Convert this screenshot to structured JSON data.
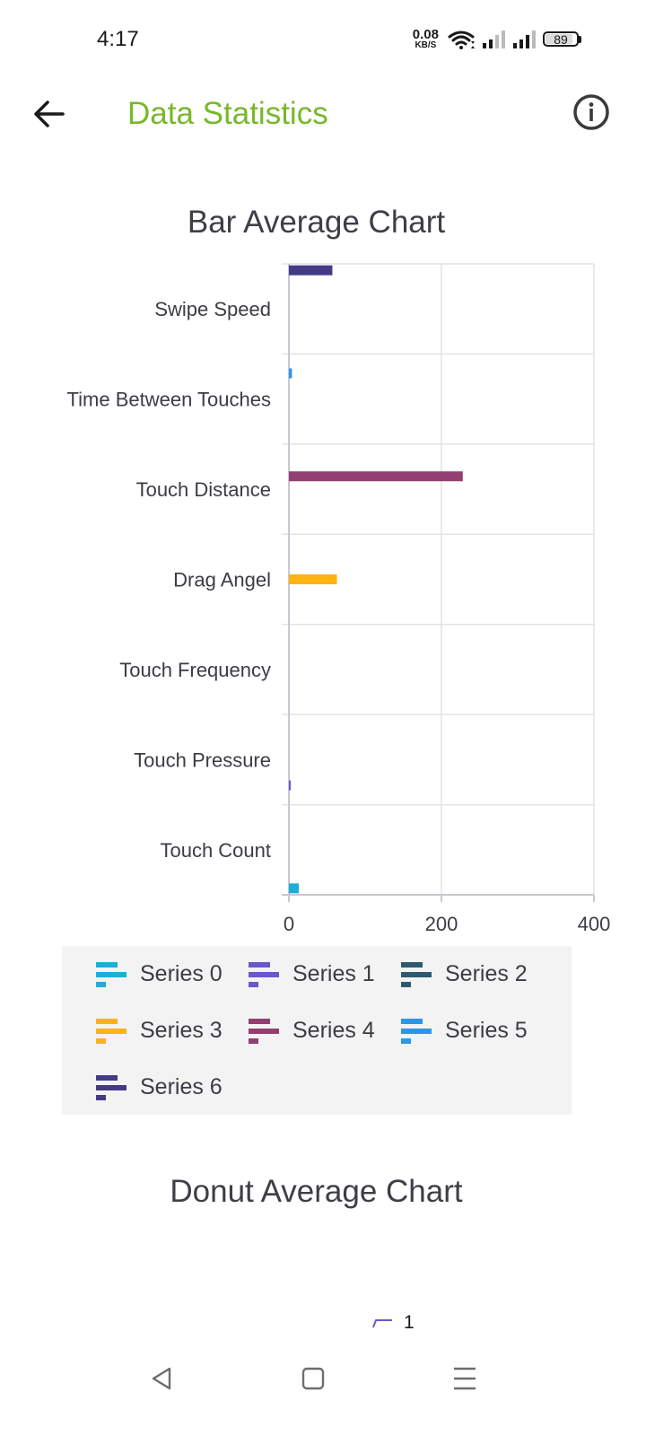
{
  "status_bar": {
    "time": "4:17",
    "net_speed_value": "0.08",
    "net_speed_unit": "KB/S",
    "battery": "89",
    "battery_level": 0.89
  },
  "app_bar": {
    "title": "Data Statistics",
    "title_color": "#78b82a"
  },
  "bar_chart_section": {
    "title": "Bar Average Chart"
  },
  "donut_section": {
    "title": "Donut Average Chart",
    "legend_label": "1",
    "legend_color": "#6a5acd"
  },
  "chart_data": {
    "type": "bar",
    "orientation": "horizontal",
    "title": "Bar Average Chart",
    "categories": [
      "Swipe Speed",
      "Time Between Touches",
      "Touch Distance",
      "Drag Angel",
      "Touch Frequency",
      "Touch Pressure",
      "Touch Count"
    ],
    "x_ticks": [
      "0",
      "200",
      "400"
    ],
    "xlim": [
      0,
      400
    ],
    "grid": true,
    "legend_position": "bottom",
    "series": [
      {
        "name": "Series 0",
        "color": "#1eaed8",
        "category": "Touch Count",
        "value": 13
      },
      {
        "name": "Series 1",
        "color": "#6a57c9",
        "category": "Touch Pressure",
        "value": 1
      },
      {
        "name": "Series 2",
        "color": "#2e5a6e",
        "category": "Touch Frequency",
        "value": 0
      },
      {
        "name": "Series 3",
        "color": "#fbb414",
        "category": "Drag Angel",
        "value": 63
      },
      {
        "name": "Series 4",
        "color": "#933f72",
        "category": "Touch Distance",
        "value": 228
      },
      {
        "name": "Series 5",
        "color": "#2c97e6",
        "category": "Time Between Touches",
        "value": 4
      },
      {
        "name": "Series 6",
        "color": "#433b86",
        "category": "Swipe Speed",
        "value": 57
      }
    ]
  },
  "nav_bar": {
    "icons": [
      "back-triangle-icon",
      "home-square-icon",
      "menu-lines-icon"
    ]
  }
}
